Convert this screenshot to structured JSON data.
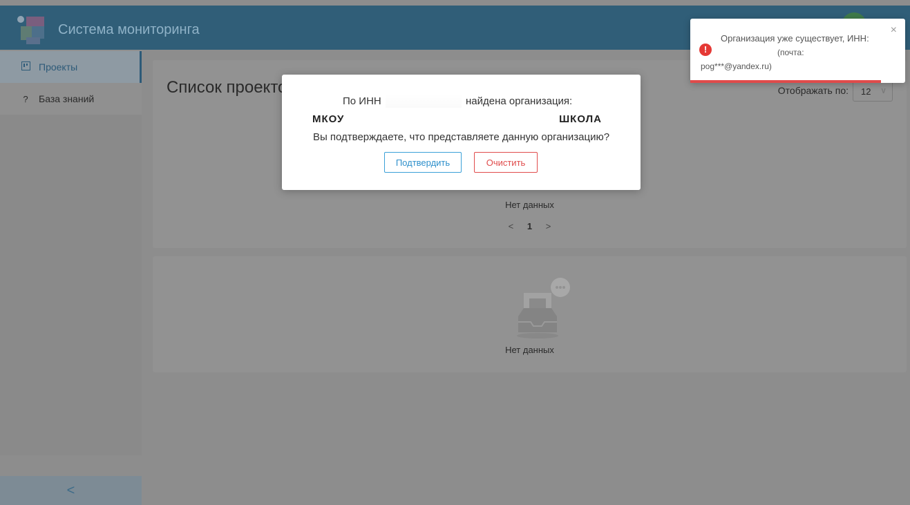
{
  "header": {
    "app_title": "Система мониторинга",
    "logo_icon": "app-logo-icon",
    "avatar_color": "#3f7a4a"
  },
  "sidebar": {
    "items": [
      {
        "label": "Проекты",
        "icon": "projects-board-icon",
        "active": true
      },
      {
        "label": "База знаний",
        "icon": "question-icon",
        "active": false
      }
    ],
    "collapse_glyph": "<"
  },
  "main": {
    "page_title": "Список проектов",
    "per_page_label": "Отображать по:",
    "per_page_value": "12",
    "empty_text_1": "Нет данных",
    "pager": {
      "prev": "<",
      "current": "1",
      "next": ">"
    },
    "empty_text_2": "Нет данных"
  },
  "modal": {
    "line1_part1": "По ИНН",
    "line1_part2": "найдена организация:",
    "org_left": "МКОУ",
    "org_right": "ШКОЛА",
    "question": "Вы подтверждаете, что представляете данную организацию?",
    "confirm_label": "Подтвердить",
    "clear_label": "Очистить"
  },
  "toast": {
    "line1": "Организация уже существует, ИНН:",
    "line2": "(почта:",
    "line3": "pog***@yandex.ru)",
    "icon": "error-icon",
    "close": "×",
    "accent_color": "#e04b4b"
  }
}
